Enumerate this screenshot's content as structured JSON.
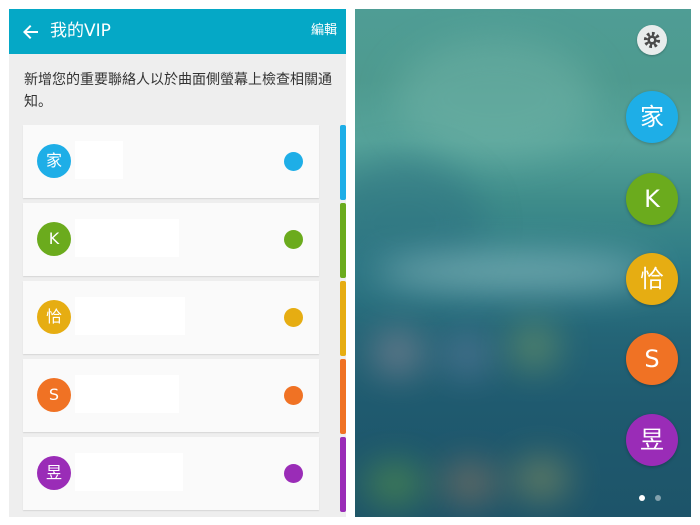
{
  "header": {
    "title": "我的VIP",
    "edit_label": "編輯"
  },
  "description": "新增您的重要聯絡人以於曲面側螢幕上檢查相關通知。",
  "contacts": [
    {
      "initial": "家",
      "color": "#1eaee7"
    },
    {
      "initial": "K",
      "color": "#6bab1d"
    },
    {
      "initial": "恰",
      "color": "#e6ad12"
    },
    {
      "initial": "S",
      "color": "#f07224"
    },
    {
      "initial": "昱",
      "color": "#9a2cb7"
    }
  ],
  "colors": {
    "accent": "#05a8c6"
  },
  "icons": {
    "back": "arrow-back-icon",
    "settings": "gear-icon"
  },
  "pager": {
    "count": 2,
    "active": 0
  }
}
